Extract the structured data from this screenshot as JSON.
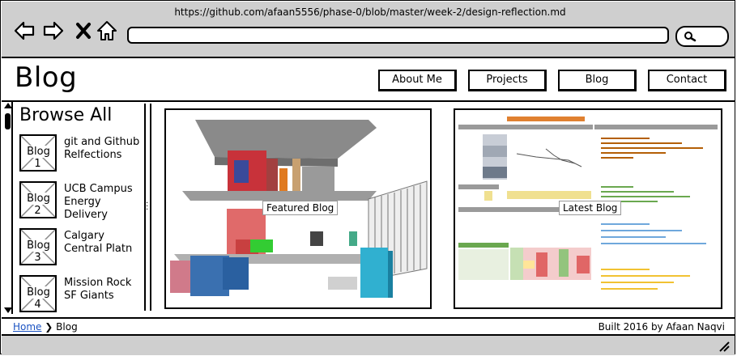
{
  "browser": {
    "url": "https://github.com/afaan5556/phase-0/blob/master/week-2/design-reflection.md",
    "icons": [
      "back-arrow-icon",
      "forward-arrow-icon",
      "close-x-icon",
      "home-icon",
      "search-icon"
    ]
  },
  "header": {
    "title": "Blog",
    "nav": [
      {
        "label": "About Me"
      },
      {
        "label": "Projects"
      },
      {
        "label": "Blog"
      },
      {
        "label": "Contact"
      }
    ]
  },
  "sidebar": {
    "heading": "Browse All",
    "items": [
      {
        "thumb": "Blog 1",
        "text": "git and Github Relfections"
      },
      {
        "thumb": "Blog 2",
        "text": "UCB Campus Energy Delivery"
      },
      {
        "thumb": "Blog 3",
        "text": "Calgary Central Platn"
      },
      {
        "thumb": "Blog 4",
        "text": "Mission Rock SF Giants"
      }
    ]
  },
  "main": {
    "featured_label": "Featured Blog",
    "latest_label": "Latest Blog"
  },
  "footer": {
    "breadcrumb_home": "Home",
    "breadcrumb_sep": "❯",
    "breadcrumb_current": "Blog",
    "credit": "Built 2016 by Afaan Naqvi"
  }
}
